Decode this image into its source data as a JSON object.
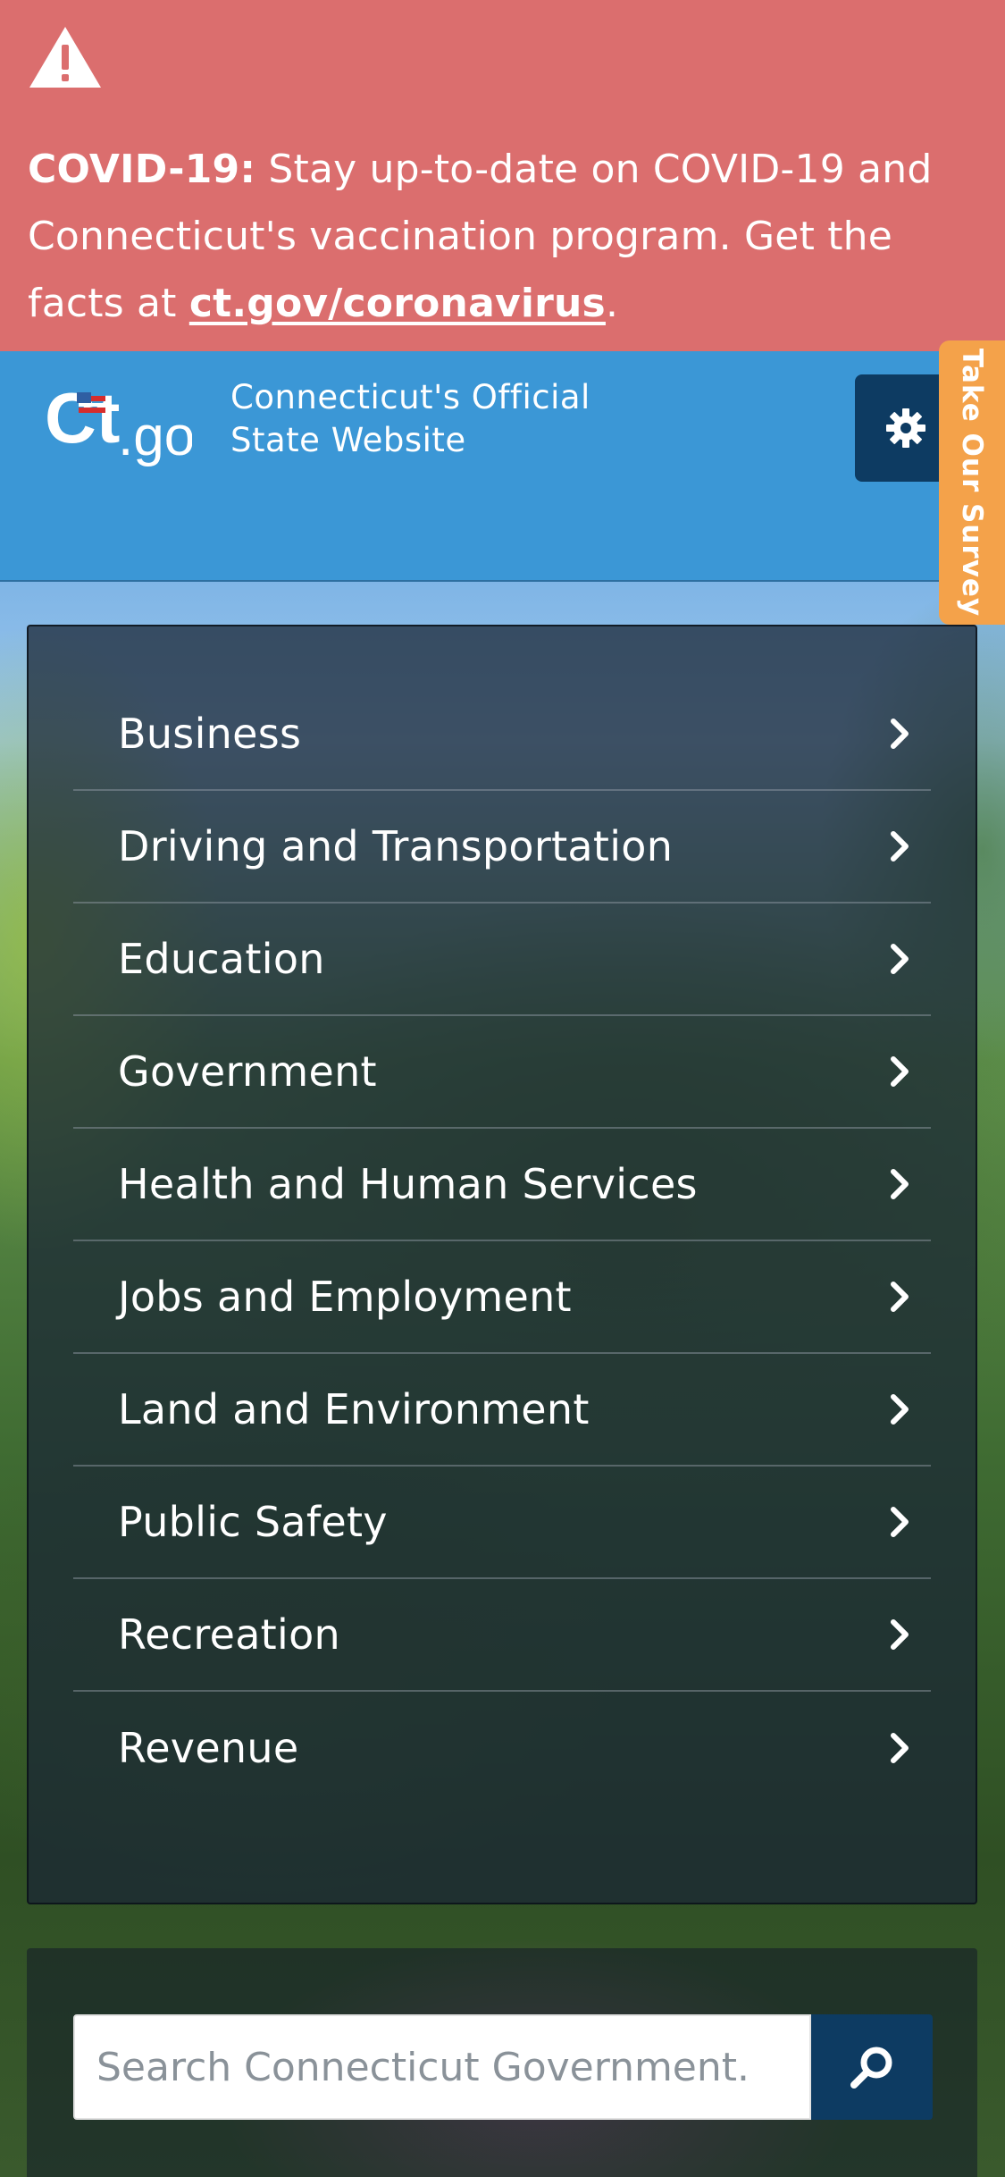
{
  "alert": {
    "icon": "warning-triangle-icon",
    "label": "COVID-19:",
    "text_before_link": " Stay up-to-date on COVID-19 and Connecticut's vaccination program. Get the facts at ",
    "link_text": "ct.gov/coronavirus",
    "text_after_link": ".",
    "background": "#db6e6e"
  },
  "header": {
    "logo_text": "Ct.gov",
    "tagline_line1": "Connecticut's Official",
    "tagline_line2": "State Website",
    "settings_icon": "gear-icon",
    "background": "#3b97d6"
  },
  "survey": {
    "label": "Take Our Survey",
    "color": "#f4a24a"
  },
  "menu": {
    "items": [
      {
        "label": "Business"
      },
      {
        "label": "Driving and Transportation"
      },
      {
        "label": "Education"
      },
      {
        "label": "Government"
      },
      {
        "label": "Health and Human Services"
      },
      {
        "label": "Jobs and Employment"
      },
      {
        "label": "Land and Environment"
      },
      {
        "label": "Public Safety"
      },
      {
        "label": "Recreation"
      },
      {
        "label": "Revenue"
      }
    ],
    "item_icon": "chevron-right-icon"
  },
  "search": {
    "placeholder": "Search Connecticut Government.",
    "button_icon": "search-icon",
    "button_color": "#0d3b62"
  }
}
